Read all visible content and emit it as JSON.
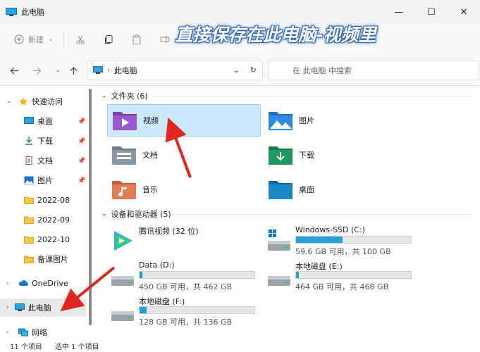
{
  "window": {
    "title": "此电脑",
    "minimize_glyph": "—",
    "maximize_glyph": "☐",
    "close_glyph": "✕"
  },
  "toolbar": {
    "new_label": "新建",
    "new_icon": "plus-circle-icon",
    "cut_icon": "scissors-icon",
    "copy_icon": "copy-icon",
    "paste_icon": "paste-icon",
    "rename_icon": "rename-icon"
  },
  "address": {
    "crumb": "此电脑",
    "search_placeholder": "在 此电脑 中搜索"
  },
  "sidebar": {
    "items": [
      {
        "label": "快速访问",
        "icon": "star-icon",
        "pinned": false
      },
      {
        "label": "桌面",
        "icon": "desktop-icon",
        "pinned": true
      },
      {
        "label": "下载",
        "icon": "download-icon",
        "pinned": true
      },
      {
        "label": "文档",
        "icon": "document-icon",
        "pinned": true
      },
      {
        "label": "图片",
        "icon": "picture-icon",
        "pinned": true
      },
      {
        "label": "2022-08",
        "icon": "folder-icon",
        "pinned": false
      },
      {
        "label": "2022-09",
        "icon": "folder-icon",
        "pinned": false
      },
      {
        "label": "2022-10",
        "icon": "folder-icon",
        "pinned": false
      },
      {
        "label": "备课图片",
        "icon": "folder-icon",
        "pinned": false
      },
      {
        "label": "OneDrive",
        "icon": "cloud-icon",
        "pinned": false
      },
      {
        "label": "此电脑",
        "icon": "computer-icon",
        "pinned": false
      },
      {
        "label": "网络",
        "icon": "network-icon",
        "pinned": false
      }
    ]
  },
  "folders_group": {
    "header": "文件夹 (6)",
    "items": [
      {
        "label": "视频",
        "icon": "video-folder-icon",
        "selected": true
      },
      {
        "label": "图片",
        "icon": "pictures-folder-icon",
        "selected": false
      },
      {
        "label": "文档",
        "icon": "documents-folder-icon",
        "selected": false
      },
      {
        "label": "下载",
        "icon": "downloads-folder-icon",
        "selected": false
      },
      {
        "label": "音乐",
        "icon": "music-folder-icon",
        "selected": false
      },
      {
        "label": "桌面",
        "icon": "desktop-folder-icon",
        "selected": false
      }
    ]
  },
  "drives_group": {
    "header": "设备和驱动器 (5)",
    "items": [
      {
        "name": "腾讯视频 (32 位)",
        "icon": "tencent-video-icon",
        "free_text": "",
        "used_fraction": null
      },
      {
        "name": "Windows-SSD (C:)",
        "icon": "windows-drive-icon",
        "free_text": "59.6 GB 可用，共 100 GB",
        "used_fraction": 0.404
      },
      {
        "name": "Data (D:)",
        "icon": "drive-icon",
        "free_text": "450 GB 可用，共 462 GB",
        "used_fraction": 0.026
      },
      {
        "name": "本地磁盘 (E:)",
        "icon": "drive-icon",
        "free_text": "464 GB 可用，共 468 GB",
        "used_fraction": 0.009
      },
      {
        "name": "本地磁盘 (F:)",
        "icon": "drive-icon",
        "free_text": "128 GB 可用，共 136 GB",
        "used_fraction": 0.059
      }
    ]
  },
  "status": {
    "count": "11 个项目",
    "selection": "选中 1 个项目"
  },
  "overlay": {
    "caption": "直接保存在此电脑-视频里",
    "arrow_color": "#e0261f"
  },
  "colors": {
    "accent": "#0067c0",
    "selection_bg": "#cce8ff",
    "drive_bar": "#26a0da"
  }
}
